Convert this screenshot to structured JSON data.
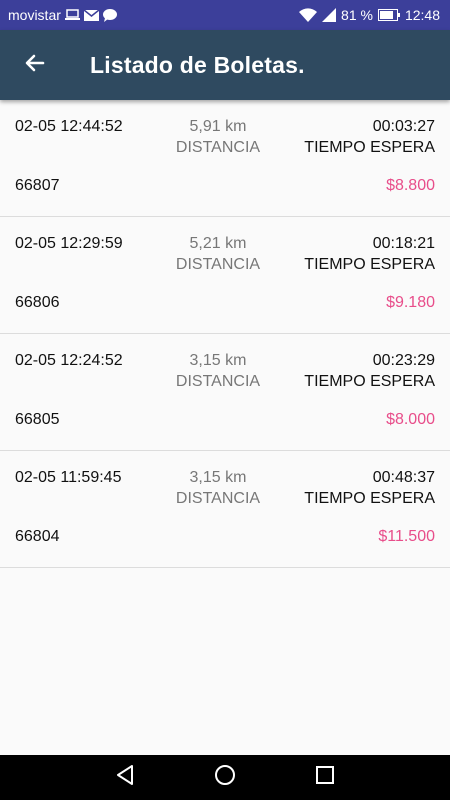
{
  "status_bar": {
    "carrier": "movistar",
    "battery": "81 %",
    "time": "12:48"
  },
  "header": {
    "title": "Listado de Boletas."
  },
  "labels": {
    "distance": "DISTANCIA",
    "wait_time": "TIEMPO ESPERA"
  },
  "colors": {
    "status_bar": "#3c3f9a",
    "app_bar": "#2f4a60",
    "amount": "#e84d8a"
  },
  "receipts": [
    {
      "datetime": "02-05 12:44:52",
      "distance": "5,91 km",
      "wait": "00:03:27",
      "id": "66807",
      "amount": "$8.800"
    },
    {
      "datetime": "02-05 12:29:59",
      "distance": "5,21 km",
      "wait": "00:18:21",
      "id": "66806",
      "amount": "$9.180"
    },
    {
      "datetime": "02-05 12:24:52",
      "distance": "3,15 km",
      "wait": "00:23:29",
      "id": "66805",
      "amount": "$8.000"
    },
    {
      "datetime": "02-05 11:59:45",
      "distance": "3,15 km",
      "wait": "00:48:37",
      "id": "66804",
      "amount": "$11.500"
    }
  ],
  "nav": {
    "icons": [
      "back-triangle-icon",
      "home-circle-icon",
      "recents-square-icon"
    ]
  }
}
